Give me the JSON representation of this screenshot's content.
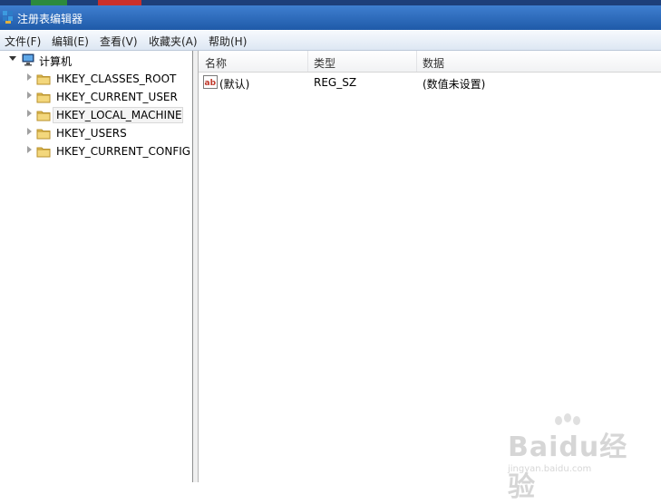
{
  "window": {
    "title": "注册表编辑器"
  },
  "menu": {
    "items": [
      "文件(F)",
      "编辑(E)",
      "查看(V)",
      "收藏夹(A)",
      "帮助(H)"
    ]
  },
  "tree": {
    "root_label": "计算机",
    "keys": [
      "HKEY_CLASSES_ROOT",
      "HKEY_CURRENT_USER",
      "HKEY_LOCAL_MACHINE",
      "HKEY_USERS",
      "HKEY_CURRENT_CONFIG"
    ],
    "selected_index": 2
  },
  "list": {
    "columns": [
      "名称",
      "类型",
      "数据"
    ],
    "rows": [
      {
        "name": "(默认)",
        "type": "REG_SZ",
        "data": "(数值未设置)"
      }
    ]
  },
  "watermark": {
    "logo": "Baidu经验",
    "url": "jingyan.baidu.com"
  },
  "colors": {
    "title_bar": "#2a66b8",
    "menu_bar": "#e6edf6",
    "selection": "#f4f4f4"
  }
}
